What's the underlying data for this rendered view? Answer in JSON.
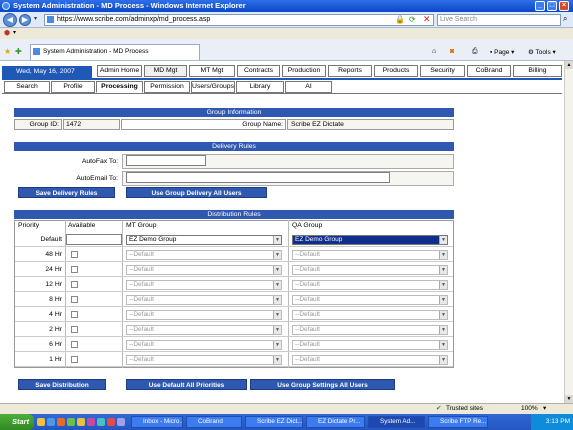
{
  "window": {
    "title": "System Administration - MD Process - Windows Internet Explorer"
  },
  "browser": {
    "url": "https://www.scribe.com/adminxp/md_process.asp",
    "search_placeholder": "Live Search",
    "tab_title": "System Administration - MD Process",
    "page_menu": "Page",
    "tools_menu": "Tools"
  },
  "app": {
    "date": "Wed, May 16, 2007",
    "nav_tabs": [
      "Admin Home",
      "MD Mgt",
      "MT Mgt",
      "Contracts",
      "Production",
      "Reports",
      "Products",
      "Security",
      "CoBrand",
      "Billing"
    ],
    "sub_tabs": [
      "Search",
      "Profile",
      "Processing",
      "Permission",
      "Users/Groups",
      "Library",
      "AI"
    ]
  },
  "group_info": {
    "header": "Group Information",
    "group_id_label": "Group ID:",
    "group_id": "1472",
    "group_name_label": "Group Name:",
    "group_name": "Scribe EZ Dictate"
  },
  "delivery": {
    "header": "Delivery Rules",
    "autofax_label": "AutoFax To:",
    "autoemail_label": "AutoEmail To:",
    "save_button": "Save Delivery Rules",
    "use_group_button": "Use Group Delivery All Users"
  },
  "distribution": {
    "header": "Distribution Rules",
    "col_priority": "Priority",
    "col_available": "Available",
    "col_mt": "MT Group",
    "col_qa": "QA Group",
    "rows": [
      {
        "priority": "Default",
        "mt": "EZ Demo Group",
        "qa": "EZ Demo Group"
      },
      {
        "priority": "48 Hr",
        "mt": "--Default",
        "qa": "--Default"
      },
      {
        "priority": "24 Hr",
        "mt": "--Default",
        "qa": "--Default"
      },
      {
        "priority": "12 Hr",
        "mt": "--Default",
        "qa": "--Default"
      },
      {
        "priority": "8 Hr",
        "mt": "--Default",
        "qa": "--Default"
      },
      {
        "priority": "4 Hr",
        "mt": "--Default",
        "qa": "--Default"
      },
      {
        "priority": "2 Hr",
        "mt": "--Default",
        "qa": "--Default"
      },
      {
        "priority": "6 Hr",
        "mt": "--Default",
        "qa": "--Default"
      },
      {
        "priority": "1 Hr",
        "mt": "--Default",
        "qa": "--Default"
      }
    ],
    "save_button": "Save Distribution",
    "default_priorities_button": "Use Default All Priorities",
    "group_settings_button": "Use Group Settings All Users"
  },
  "status": {
    "zone": "Trusted sites",
    "zoom": "100%"
  },
  "taskbar": {
    "start": "Start",
    "items": [
      "Inbox - Micro...",
      "CoBrand",
      "Scribe EZ Dict...",
      "EZ Dictate Pr...",
      "System Ad...",
      "Scribe FTP Re..."
    ],
    "time": "3:13 PM"
  },
  "colors": {
    "accent": "#2f59b0",
    "title": "#0a46c8"
  }
}
